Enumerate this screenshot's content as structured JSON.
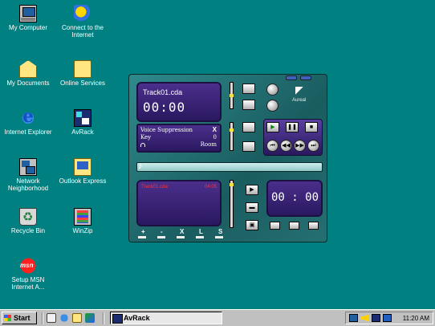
{
  "desktop": {
    "icons": [
      {
        "label": "My Computer"
      },
      {
        "label": "Connect to the Internet"
      },
      {
        "label": "My Documents"
      },
      {
        "label": "Online Services"
      },
      {
        "label": "Internet Explorer"
      },
      {
        "label": "AvRack"
      },
      {
        "label": "Network Neighborhood"
      },
      {
        "label": "Outlook Express"
      },
      {
        "label": "Recycle Bin"
      },
      {
        "label": "WinZip"
      },
      {
        "label": "Setup MSN Internet A..."
      }
    ]
  },
  "player": {
    "track": "Track01.cda",
    "time": "00:00",
    "voice_label": "Voice Suppression",
    "voice_close": "X",
    "key_label": "Key",
    "key_value": "0",
    "room_label": "Room",
    "brand": "Aureal",
    "playlist_track": "Track01.cda",
    "playlist_time": "04:05",
    "small_time": "00 : 00",
    "eq_labels": [
      "+",
      "-",
      "X",
      "L",
      "S"
    ],
    "accent_color": "#4b2f8c"
  },
  "taskbar": {
    "start_label": "Start",
    "task_label": "AvRack",
    "clock": "11:20 AM"
  }
}
